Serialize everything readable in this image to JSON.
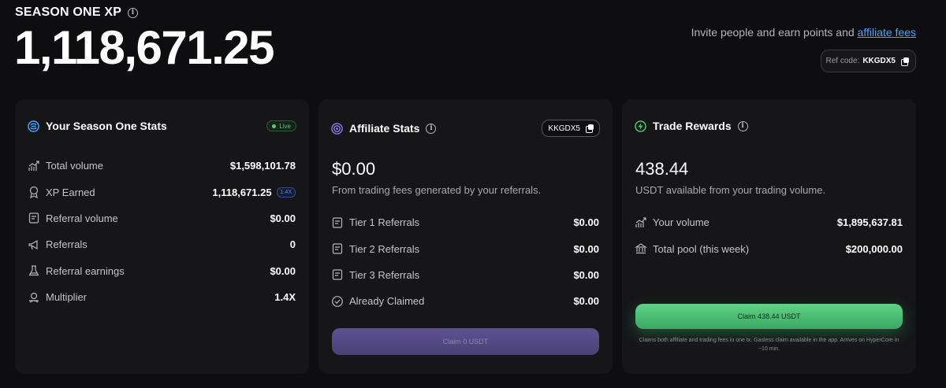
{
  "header": {
    "title": "SEASON ONE XP",
    "xp_total": "1,118,671.25",
    "invite_text": "Invite people and earn points and",
    "invite_link": "affiliate fees",
    "ref_label": "Ref code:",
    "ref_code": "KKGDX5"
  },
  "season_stats": {
    "title": "Your Season One Stats",
    "live_label": "Live",
    "rows": [
      {
        "label": "Total volume",
        "value": "$1,598,101.78",
        "icon": "chart-up-icon"
      },
      {
        "label": "XP Earned",
        "value": "1,118,671.25",
        "badge": "1.4X",
        "icon": "medal-icon"
      },
      {
        "label": "Referral volume",
        "value": "$0.00",
        "icon": "receipt-icon"
      },
      {
        "label": "Referrals",
        "value": "0",
        "icon": "megaphone-icon"
      },
      {
        "label": "Referral earnings",
        "value": "$0.00",
        "icon": "flask-icon"
      },
      {
        "label": "Multiplier",
        "value": "1.4X",
        "icon": "person-pin-icon"
      }
    ]
  },
  "affiliate_stats": {
    "title": "Affiliate Stats",
    "code_badge": "KKGDX5",
    "amount": "$0.00",
    "amount_desc": "From trading fees generated by your referrals.",
    "rows": [
      {
        "label": "Tier 1 Referrals",
        "value": "$0.00",
        "icon": "receipt-icon"
      },
      {
        "label": "Tier 2 Referrals",
        "value": "$0.00",
        "icon": "receipt-icon"
      },
      {
        "label": "Tier 3 Referrals",
        "value": "$0.00",
        "icon": "receipt-icon"
      },
      {
        "label": "Already Claimed",
        "value": "$0.00",
        "icon": "check-circle-icon"
      }
    ],
    "claim_button": "Claim 0 USDT"
  },
  "trade_rewards": {
    "title": "Trade Rewards",
    "amount": "438.44",
    "amount_desc": "USDT available from your trading volume.",
    "rows": [
      {
        "label": "Your volume",
        "value": "$1,895,637.81",
        "icon": "chart-up-icon"
      },
      {
        "label": "Total pool (this week)",
        "value": "$200,000.00",
        "icon": "bank-icon"
      }
    ],
    "claim_button": "Claim 438.44 USDT",
    "claim_note": "Claims both affiliate and trading fees in one tx. Gasless claim available in the app. Arrives on HyperCore in ~10 min."
  },
  "colors": {
    "background": "#0e0e10",
    "card": "#161618",
    "link": "#4aa3ff",
    "live_green": "#4ed36b",
    "claim_green": "#5ed485",
    "claim_purple": "#5d528f"
  }
}
